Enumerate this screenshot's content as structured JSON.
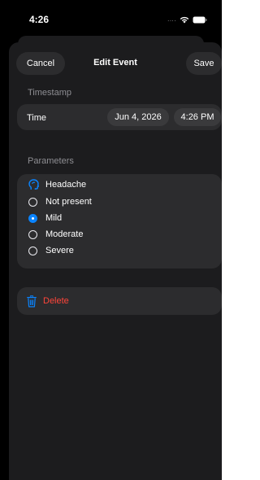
{
  "status_bar": {
    "time": "4:26",
    "signal": "...."
  },
  "nav": {
    "cancel_label": "Cancel",
    "title": "Edit Event",
    "save_label": "Save"
  },
  "timestamp": {
    "header": "Timestamp",
    "row_label": "Time",
    "date_value": "Jun 4, 2026",
    "time_value": "4:26 PM"
  },
  "parameters": {
    "header": "Parameters",
    "name": "Headache",
    "options": [
      {
        "label": "Not present",
        "selected": false
      },
      {
        "label": "Mild",
        "selected": true
      },
      {
        "label": "Moderate",
        "selected": false
      },
      {
        "label": "Severe",
        "selected": false
      }
    ]
  },
  "delete": {
    "label": "Delete"
  },
  "colors": {
    "accent": "#0a84ff",
    "destructive": "#ff453a",
    "background": "#1c1c1e",
    "group": "#2c2c2e"
  }
}
